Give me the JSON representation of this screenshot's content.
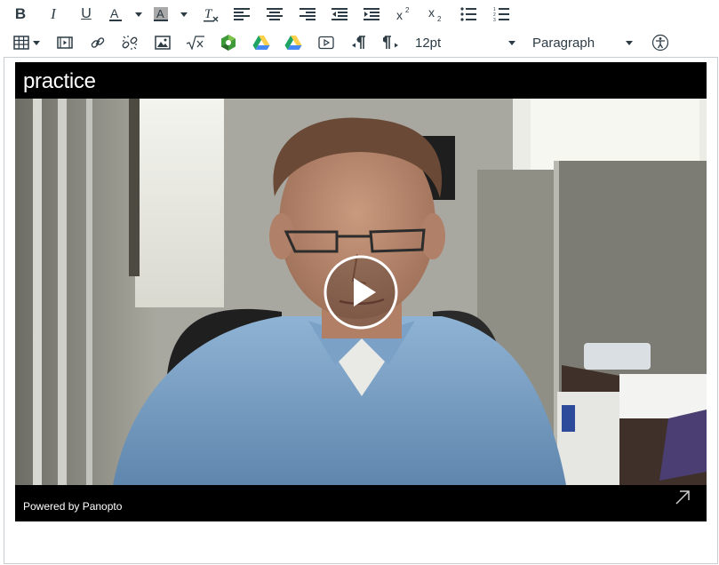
{
  "toolbar": {
    "bold": "B",
    "italic": "I",
    "underline": "U",
    "font_size": "12pt",
    "block_format": "Paragraph"
  },
  "video": {
    "title": "practice",
    "powered_by": "Powered by Panopto"
  },
  "colors": {
    "toolbar_icon": "#2d3b45",
    "google_drive_green": "#1fa463",
    "google_drive_yellow": "#ffd04b",
    "google_drive_blue": "#4688f4",
    "video_bg": "#000000"
  }
}
